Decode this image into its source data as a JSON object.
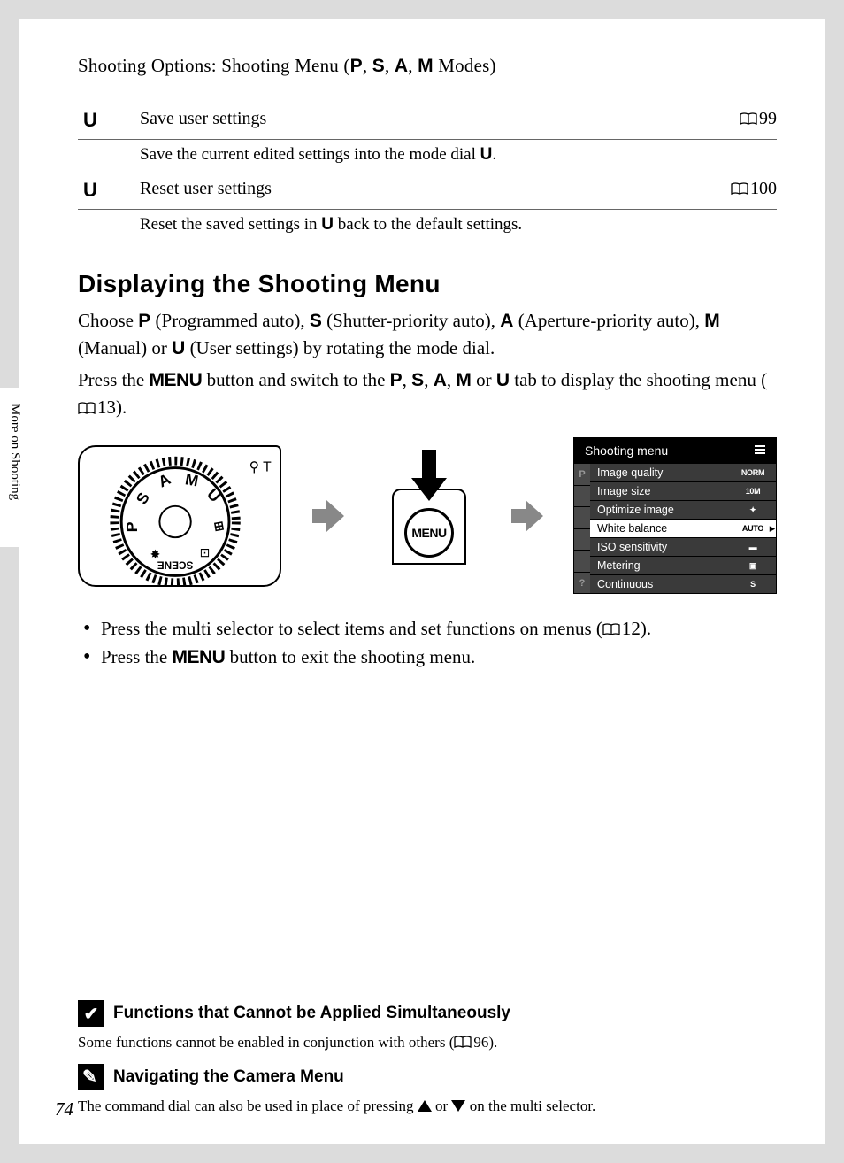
{
  "sidebar_label": "More on Shooting",
  "header": {
    "prefix": "Shooting Options: Shooting Menu (",
    "modes": [
      "P",
      "S",
      "A",
      "M"
    ],
    "suffix": " Modes)"
  },
  "settings": [
    {
      "symbol": "U",
      "title": "Save user settings",
      "page": "99",
      "desc_pre": "Save the current edited settings into the mode dial ",
      "desc_sym": "U",
      "desc_post": "."
    },
    {
      "symbol": "U",
      "title": "Reset user settings",
      "page": "100",
      "desc_pre": "Reset the saved settings in ",
      "desc_sym": "U",
      "desc_post": " back to the default settings."
    }
  ],
  "section_heading": "Displaying the Shooting Menu",
  "para1": {
    "t1": "Choose ",
    "m1": "P",
    "d1": " (Programmed auto), ",
    "m2": "S",
    "d2": " (Shutter-priority auto), ",
    "m3": "A",
    "d3": " (Aperture-priority auto), ",
    "m4": "M",
    "d4": " (Manual) or ",
    "m5": "U",
    "d5": " (User settings) by rotating the mode dial."
  },
  "para2": {
    "t1": "Press the ",
    "menu": "MENU",
    "t2": " button and switch to the ",
    "m1": "P",
    "c": ", ",
    "m2": "S",
    "m3": "A",
    "m4": "M",
    "or": " or ",
    "m5": "U",
    "t3": " tab to display the shooting menu (",
    "pg": "13",
    "t4": ")."
  },
  "lcd": {
    "title": "Shooting menu",
    "side_letters": [
      "P",
      "",
      "",
      "",
      "",
      "?"
    ],
    "rows": [
      {
        "label": "Image quality",
        "val": "NORM",
        "sel": false
      },
      {
        "label": "Image size",
        "val": "10M",
        "sel": false
      },
      {
        "label": "Optimize image",
        "val": "✦",
        "sel": false
      },
      {
        "label": "White balance",
        "val": "AUTO",
        "sel": true
      },
      {
        "label": "ISO sensitivity",
        "val": "▬",
        "sel": false
      },
      {
        "label": "Metering",
        "val": "▣",
        "sel": false
      },
      {
        "label": "Continuous",
        "val": "S",
        "sel": false
      }
    ]
  },
  "bullets": {
    "b1a": "Press the multi selector to select items and set functions on menus (",
    "b1pg": "12",
    "b1b": ").",
    "b2a": "Press the ",
    "b2menu": "MENU",
    "b2b": " button to exit the shooting menu."
  },
  "foot1": {
    "head": "Functions that Cannot be Applied Simultaneously",
    "text_a": "Some functions cannot be enabled in conjunction with others (",
    "pg": "96",
    "text_b": ")."
  },
  "foot2": {
    "head": "Navigating the Camera Menu",
    "text_a": "The command dial can also be used in place of pressing ",
    "text_mid": " or ",
    "text_b": " on the multi selector."
  },
  "page_number": "74",
  "menu_label": "MENU"
}
